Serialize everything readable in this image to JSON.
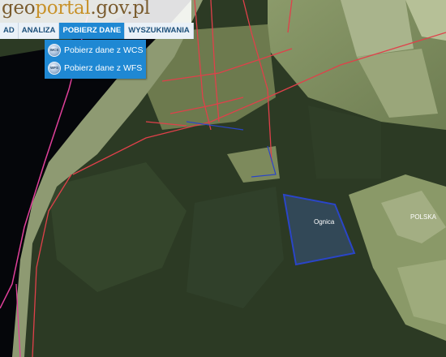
{
  "header": {
    "logo_part1": "geo",
    "logo_part2": "portal",
    "logo_part3": ".gov.pl"
  },
  "toolbar": {
    "items": [
      "AD",
      "ANALIZA",
      "POBIERZ DANE",
      "WYSZUKIWANIA"
    ],
    "active_index": 2
  },
  "dropdown": {
    "items": [
      {
        "label": "Pobierz dane z WCS",
        "icon": "globe-icon",
        "icon_text": "WCS"
      },
      {
        "label": "Pobierz dane z WFS",
        "icon": "globe-icon",
        "icon_text": "WFS"
      }
    ]
  },
  "map": {
    "labels": {
      "polygon": "Ognica",
      "country": "POLSKA"
    },
    "colors": {
      "road": "#e0404a",
      "border": "#e0409a",
      "parcel": "#2a45c8",
      "river": "#05060a",
      "forest": "#273520"
    }
  }
}
